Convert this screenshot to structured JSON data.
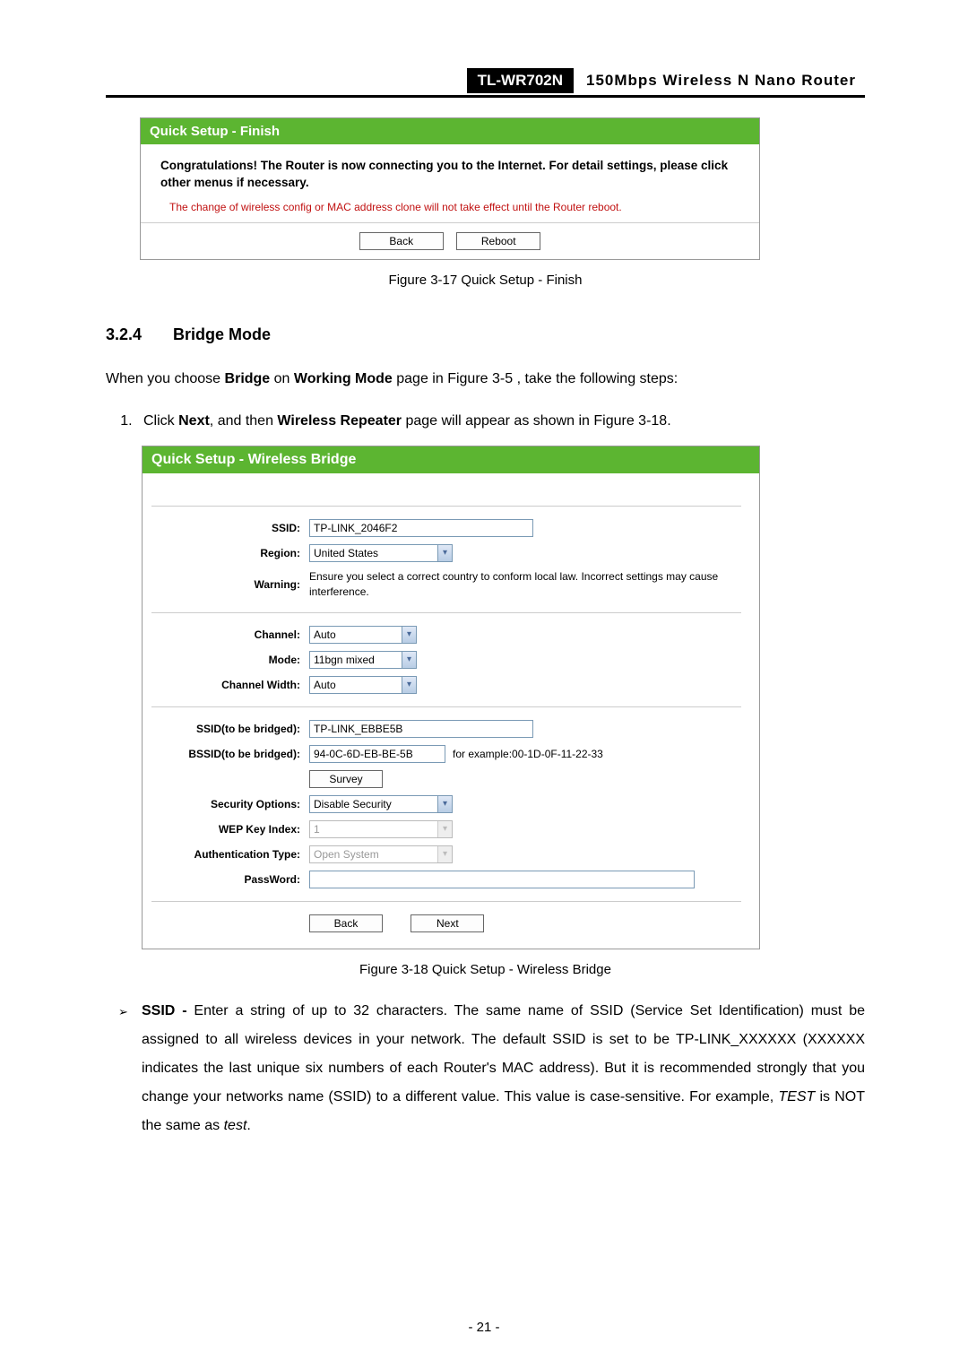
{
  "header": {
    "model": "TL-WR702N",
    "product": "150Mbps  Wireless  N  Nano  Router"
  },
  "finish": {
    "title": "Quick Setup - Finish",
    "congrats": "Congratulations! The Router is now connecting you to the Internet. For detail settings, please click other menus if necessary.",
    "warn": "The change of wireless config or MAC address clone will not take effect until the Router reboot.",
    "back": "Back",
    "reboot": "Reboot",
    "caption": "Figure 3-17 Quick Setup - Finish"
  },
  "section": {
    "num": "3.2.4",
    "title": "Bridge Mode"
  },
  "intro": {
    "pre": "When you choose ",
    "b1": "Bridge",
    "mid1": " on ",
    "b2": "Working Mode",
    "post": " page in Figure 3-5 , take the following steps:"
  },
  "step1": {
    "pre": "Click ",
    "b1": "Next",
    "mid1": ", and then ",
    "b2": "Wireless Repeater",
    "post": " page will appear as shown in Figure 3-18."
  },
  "bridge": {
    "title": "Quick Setup - Wireless Bridge",
    "labels": {
      "ssid": "SSID:",
      "region": "Region:",
      "warning": "Warning:",
      "channel": "Channel:",
      "mode": "Mode:",
      "chwidth": "Channel Width:",
      "ssid_b": "SSID(to be bridged):",
      "bssid_b": "BSSID(to be bridged):",
      "survey": "Survey",
      "sec": "Security Options:",
      "wep": "WEP Key Index:",
      "auth": "Authentication Type:",
      "pass": "PassWord:"
    },
    "values": {
      "ssid": "TP-LINK_2046F2",
      "region": "United States",
      "warning": "Ensure you select a correct country to conform local law. Incorrect settings may cause interference.",
      "channel": "Auto",
      "mode": "11bgn mixed",
      "chwidth": "Auto",
      "ssid_b": "TP-LINK_EBBE5B",
      "bssid_b": "94-0C-6D-EB-BE-5B",
      "example": "for example:00-1D-0F-11-22-33",
      "sec": "Disable Security",
      "wep": "1",
      "auth": "Open System",
      "pass": ""
    },
    "back": "Back",
    "next": "Next",
    "caption": "Figure 3-18 Quick Setup - Wireless Bridge"
  },
  "bullet": {
    "mark": "➢",
    "b1": "SSID  - ",
    "rest_a": "Enter  a  string  of  up  to  32  characters.  The  same  name  of  SSID  (Service  Set Identification) must be assigned to all wireless devices in your network. The default SSID is set  to  be  TP-LINK_XXXXXX  (XXXXXX  indicates  the  last  unique  six  numbers  of  each Router's  MAC  address).  But  it  is  recommended  strongly  that  you  change  your  networks name  (SSID)  to  a  different  value.  This  value  is  case-sensitive.  For  example, ",
    "i1": "TEST",
    "mid": " is  NOT the same as ",
    "i2": "test",
    "end": "."
  },
  "pagenum": "- 21 -"
}
